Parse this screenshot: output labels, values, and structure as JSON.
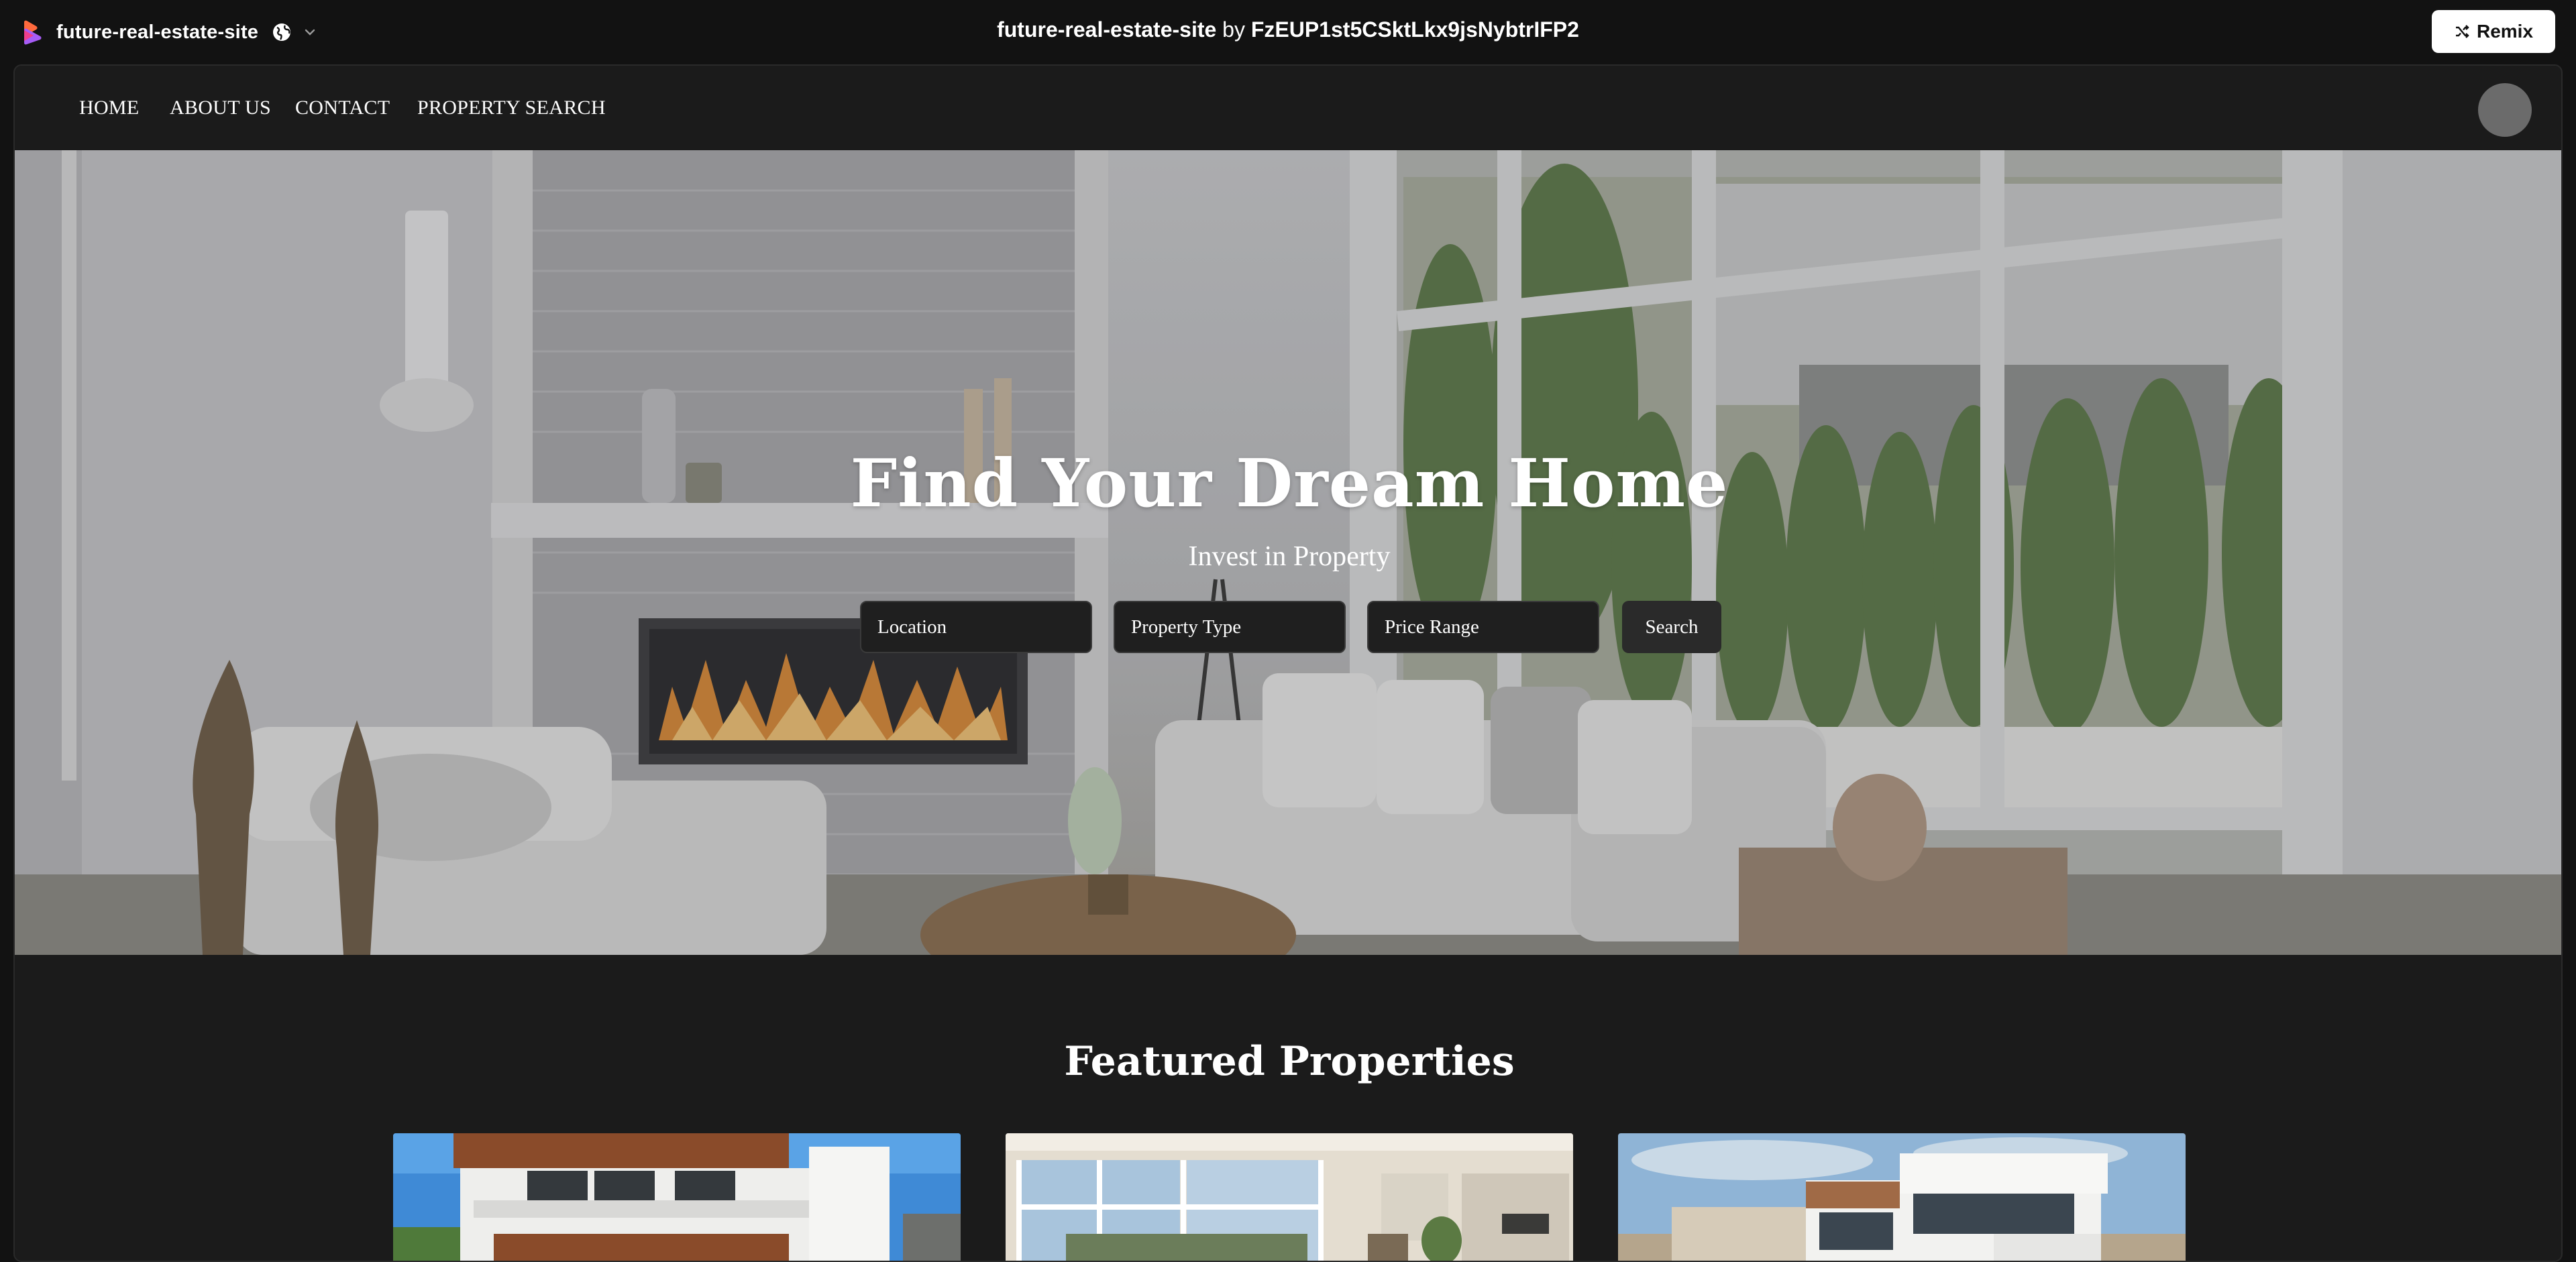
{
  "app": {
    "project_name": "future-real-estate-site",
    "title": "future-real-estate-site",
    "by_label": "by",
    "author": "FzEUP1st5CSktLkx9jsNybtrIFP2",
    "remix_label": "Remix"
  },
  "nav": {
    "items": [
      "HOME",
      "ABOUT US",
      "CONTACT",
      "PROPERTY SEARCH"
    ]
  },
  "hero": {
    "title": "Find Your Dream Home",
    "subtitle": "Invest in Property",
    "location_placeholder": "Location",
    "property_type_placeholder": "Property Type",
    "price_range_placeholder": "Price Range",
    "search_label": "Search"
  },
  "featured": {
    "title": "Featured Properties"
  },
  "icons": {
    "brand": "app-logo-icon",
    "globe": "globe-icon",
    "chevron": "chevron-down-icon",
    "remix": "shuffle-icon"
  },
  "colors": {
    "background": "#121212",
    "page": "#1b1b1b",
    "remix_button": "#ffffff",
    "field": "#1f1f1f"
  }
}
